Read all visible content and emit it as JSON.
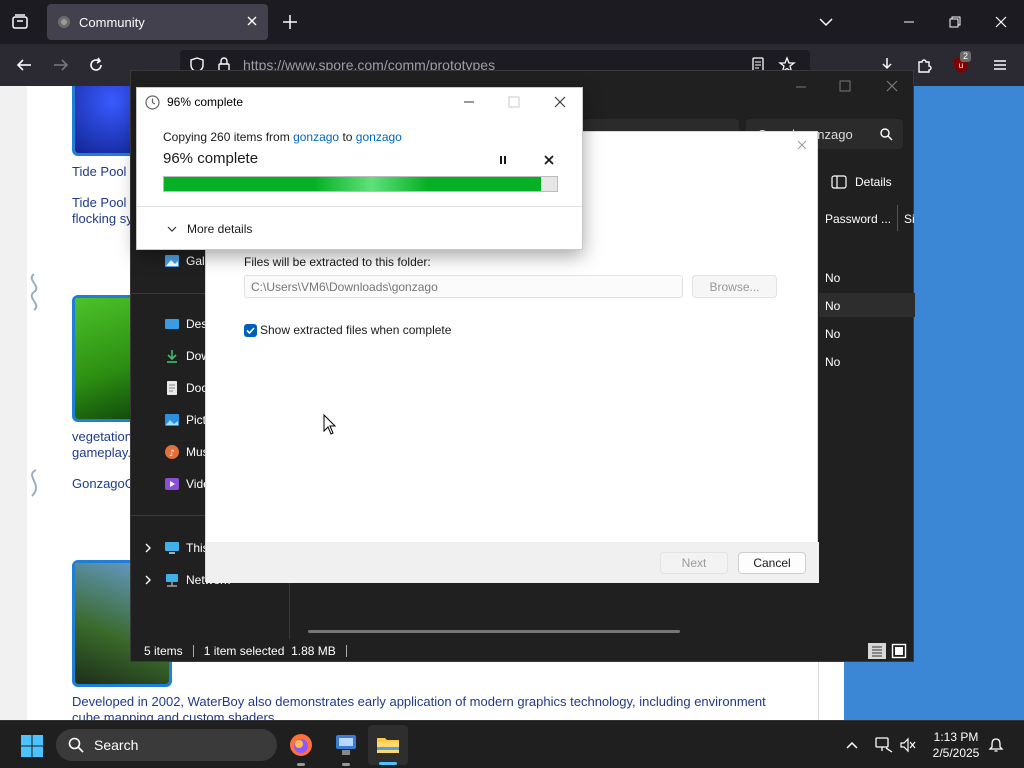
{
  "browser": {
    "tab_title": "Community",
    "url": "https://www.spore.com/comm/prototypes",
    "extensions_badge": "2"
  },
  "webpage": {
    "items": [
      {
        "link": "Tide Pool",
        "desc": "Tide Pool\nflocking sy"
      },
      {
        "link": "",
        "desc": "vegetation\ngameplay."
      },
      {
        "link": "GonzagoG",
        "desc": ""
      }
    ],
    "bottom_text": "Developed in 2002, WaterBoy also demonstrates early application of modern graphics technology, including environment cube mapping and custom shaders."
  },
  "explorer": {
    "search_placeholder": "Search gonzago",
    "details_button": "Details",
    "columns": {
      "password": "Password ...",
      "size": "Si"
    },
    "password_values": [
      "No",
      "No",
      "No",
      "No"
    ],
    "sidebar": {
      "gallery": "Gall",
      "desktop": "Des",
      "downloads": "Dow",
      "documents": "Doc",
      "pictures": "Pict",
      "music": "Mus",
      "videos": "Vide",
      "this_pc": "This",
      "network": "Network"
    },
    "status": {
      "count": "5 items",
      "selected": "1 item selected  1.88 MB"
    }
  },
  "wizard": {
    "folder_label": "Files will be extracted to this folder:",
    "folder_path": "C:\\Users\\VM6\\Downloads\\gonzago",
    "browse_button": "Browse...",
    "show_files_label": "Show extracted files when complete",
    "show_files_checked": true,
    "next_button": "Next",
    "cancel_button": "Cancel"
  },
  "copy_dialog": {
    "title": "96% complete",
    "copying_prefix": "Copying 260 items from ",
    "source": "gonzago",
    "to_word": " to ",
    "destination": "gonzago",
    "status": "96% complete",
    "progress": 0.96,
    "more_details": "More details"
  },
  "taskbar": {
    "search_label": "Search",
    "time": "1:13 PM",
    "date": "2/5/2025"
  },
  "colors": {
    "progress_green": "#06b025",
    "link_blue": "#0067c0",
    "accent": "#005fb8"
  }
}
